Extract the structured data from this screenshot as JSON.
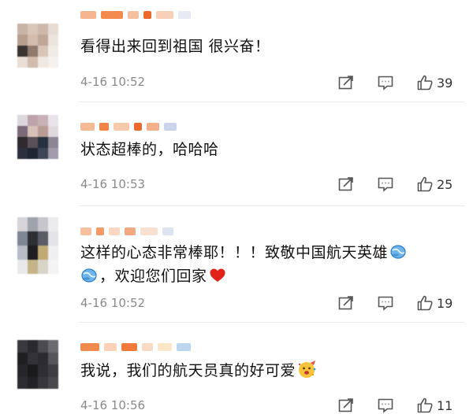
{
  "comments": [
    {
      "text": "看得出来回到祖国 很兴奋！",
      "time": "4-16 10:52",
      "likes": "39"
    },
    {
      "text": "状态超棒的，哈哈哈",
      "time": "4-16 10:53",
      "likes": "25"
    },
    {
      "text_line1": "这样的心态非常棒耶！！！致敬中国航天英雄",
      "text_line2": "，欢迎您们回家",
      "time": "4-16 10:52",
      "likes": "19"
    },
    {
      "text": "我说，我们的航天员真的好可爱",
      "time": "4-16 10:56",
      "likes": "11"
    }
  ],
  "icons": {
    "share": "share-icon",
    "reply": "comment-icon",
    "like": "thumbs-up-icon",
    "emoji_blue": "blue-earth-emoji",
    "emoji_heart": "red-heart-emoji",
    "emoji_face": "party-face-emoji"
  },
  "colors": {
    "heart": "#e2231a",
    "time": "#8a8a8a",
    "emoji_blue": "#3b93d9"
  }
}
